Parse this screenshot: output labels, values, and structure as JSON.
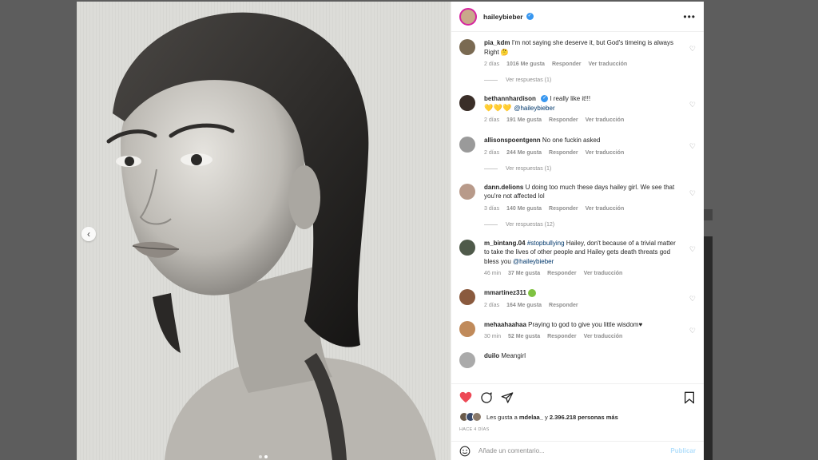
{
  "post": {
    "username": "haileybieber",
    "verified": true,
    "more_label": "•••"
  },
  "comments": [
    {
      "user": "pia_kdm",
      "text": "I'm not saying she deserve it, but God's timeing is always Right 🤔",
      "time": "2 días",
      "likes": "1016 Me gusta",
      "reply": "Responder",
      "translate": "Ver traducción",
      "replies": "Ver respuestas (1)",
      "avatar_color": "#7a6a52"
    },
    {
      "user": "bethannhardison",
      "verified": true,
      "text": "I really like it!!!",
      "text2_emoji": "💛💛💛",
      "mention": "@haileybieber",
      "time": "2 días",
      "likes": "191 Me gusta",
      "reply": "Responder",
      "translate": "Ver traducción",
      "avatar_color": "#3a2e28"
    },
    {
      "user": "allisonspoentgenn",
      "text": "No one fuckin asked",
      "time": "2 días",
      "likes": "244 Me gusta",
      "reply": "Responder",
      "translate": "Ver traducción",
      "replies": "Ver respuestas (1)",
      "avatar_color": "#9a9a9a"
    },
    {
      "user": "dann.delions",
      "text": "U doing too much these days hailey girl. We see that you're not affected lol",
      "time": "3 días",
      "likes": "140 Me gusta",
      "reply": "Responder",
      "translate": "Ver traducción",
      "replies": "Ver respuestas (12)",
      "avatar_color": "#b89a8a"
    },
    {
      "user": "m_bintang.04",
      "hashtag": "#stopbullying",
      "text": "Hailey, don't because of a trivial matter to take the lives of other people and Hailey gets death threats god bless you",
      "mention": "@haileybieber",
      "time": "46 min",
      "likes": "37 Me gusta",
      "reply": "Responder",
      "translate": "Ver traducción",
      "avatar_color": "#4f5a4a"
    },
    {
      "user": "mmartinez311",
      "text": "",
      "time": "2 días",
      "likes": "164 Me gusta",
      "reply": "Responder",
      "avatar_color": "#8a5a3e"
    },
    {
      "user": "mehaahaahaa",
      "text": "Praying to god to give you little wisdom♥",
      "time": "30 min",
      "likes": "52 Me gusta",
      "reply": "Responder",
      "translate": "Ver traducción",
      "avatar_color": "#c08a5a"
    },
    {
      "user": "duilo",
      "text": "Meangirl",
      "avatar_color": "#aaaaaa"
    }
  ],
  "likes": {
    "prefix": "Les gusta a",
    "user": "mdelaa_",
    "middle": "y",
    "count": "2.396.218 personas más"
  },
  "time_ago": "HACE 4 DÍAS",
  "add_comment": {
    "placeholder": "Añade un comentario...",
    "publish": "Publicar"
  },
  "colors": {
    "heart_red": "#ed4956",
    "link_blue": "#00376b",
    "verified_blue": "#3897f0"
  }
}
